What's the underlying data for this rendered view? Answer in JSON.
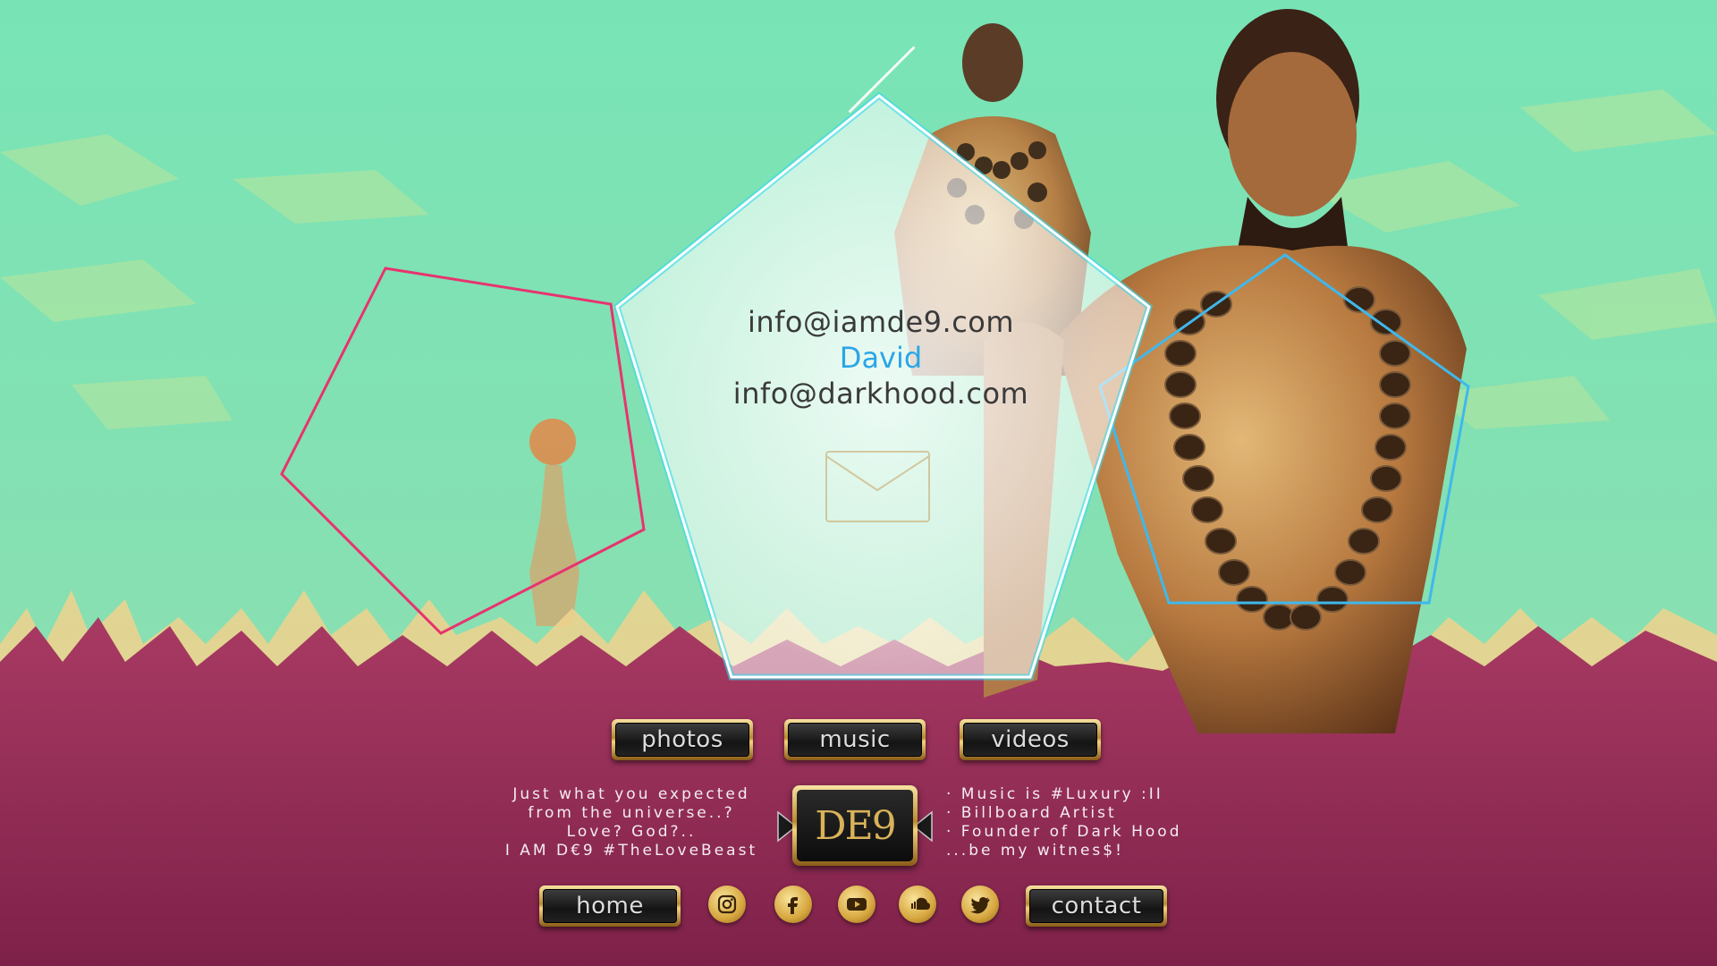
{
  "contact": {
    "email_primary": "info@iamde9.com",
    "name": "David",
    "email_secondary": "info@darkhood.com"
  },
  "nav": {
    "photos": "photos",
    "music": "music",
    "videos": "videos",
    "home": "home",
    "contact": "contact"
  },
  "tagline_left": [
    "Just what you expected",
    "from the universe..?",
    "Love? God?..",
    "I AM D€9 #TheLoveBeast"
  ],
  "tagline_right": [
    "· Music is #Luxury :II",
    "· Billboard Artist",
    "· Founder of Dark Hood",
    "...be my witnes$!"
  ],
  "logo": {
    "text": "DE9"
  },
  "social_icons": [
    "instagram-icon",
    "facebook-icon",
    "youtube-icon",
    "soundcloud-icon",
    "twitter-icon"
  ],
  "colors": {
    "sky": "#7de3b6",
    "grass": "#8c2653",
    "pentagon_pink": "#e8336f",
    "pentagon_blue": "#3fb8ec",
    "pentagon_white": "#ffffff",
    "name_blue": "#2aa6e6",
    "gold": "#d6a63e"
  }
}
